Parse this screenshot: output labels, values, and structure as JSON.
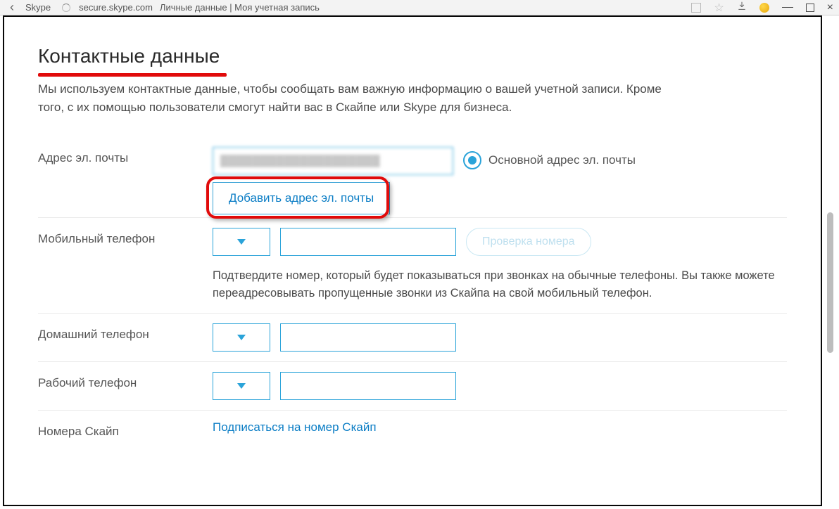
{
  "chrome": {
    "tab_label": "Skype",
    "url_host": "secure.skype.com",
    "page_title": "Личные данные | Моя учетная запись"
  },
  "heading": "Контактные данные",
  "description": "Мы используем контактные данные, чтобы сообщать вам важную информацию о вашей учетной записи. Кроме того, с их помощью пользователи смогут найти вас в Скайпе или Skype для бизнеса.",
  "email": {
    "label": "Адрес эл. почты",
    "value_masked": "████████████████████",
    "primary_label": "Основной адрес эл. почты",
    "add_button": "Добавить адрес эл. почты"
  },
  "mobile": {
    "label": "Мобильный телефон",
    "verify_button": "Проверка номера",
    "helper": "Подтвердите номер, который будет показываться при звонках на обычные телефоны. Вы также можете переадресовывать пропущенные звонки из Скайпа на свой мобильный телефон."
  },
  "home_phone": {
    "label": "Домашний телефон"
  },
  "work_phone": {
    "label": "Рабочий телефон"
  },
  "skype_numbers": {
    "label": "Номера Скайп",
    "subscribe_link": "Подписаться на номер Скайп"
  }
}
